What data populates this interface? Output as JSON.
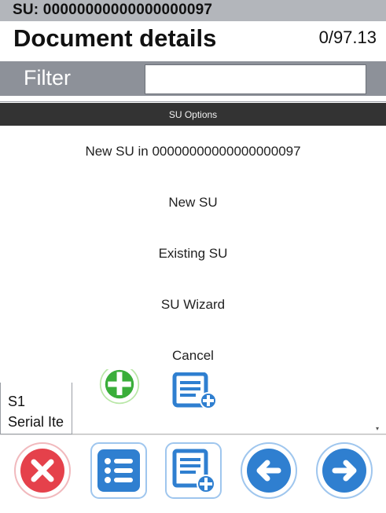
{
  "header": {
    "su_label": "SU: 00000000000000000097",
    "title": "Document details",
    "counter": "0/97.13"
  },
  "filter": {
    "label": "Filter",
    "value": ""
  },
  "modal": {
    "title": "SU Options",
    "options": [
      {
        "label": "New SU in 00000000000000000097"
      },
      {
        "label": "New SU"
      },
      {
        "label": "Existing SU"
      },
      {
        "label": "SU Wizard"
      },
      {
        "label": "Cancel"
      }
    ]
  },
  "background_row": {
    "line1": "S1",
    "line2": "Serial Ite"
  },
  "toolbar": {
    "buttons": [
      {
        "icon": "close-icon",
        "color": "#e5414b"
      },
      {
        "icon": "list-icon",
        "color": "#2f7fd0"
      },
      {
        "icon": "document-add-icon",
        "color": "#2f7fd0"
      },
      {
        "icon": "arrow-left-icon",
        "color": "#2f7fd0"
      },
      {
        "icon": "arrow-right-icon",
        "color": "#2f7fd0"
      }
    ]
  }
}
